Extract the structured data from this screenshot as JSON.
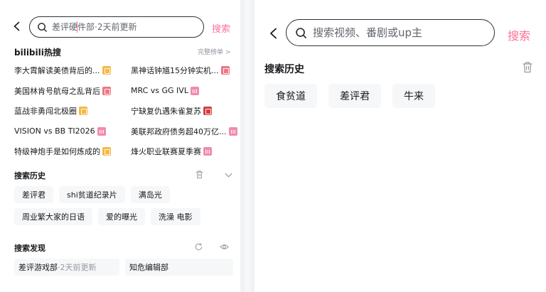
{
  "left": {
    "search": {
      "placeholder": "差评硬件部·2天前更新",
      "button": "搜索"
    },
    "hot": {
      "title": "bilibili热搜",
      "more": "完整榜单 >",
      "items": [
        {
          "text": "李大霄解读美债背后的...",
          "tag": "new"
        },
        {
          "text": "黑神话钟馗15分钟实机...",
          "tag": "hot"
        },
        {
          "text": "美国林肯号航母之乱背后",
          "tag": "hot"
        },
        {
          "text": "MRC vs GG IVL",
          "tag": "bar"
        },
        {
          "text": "蓝战非勇闯北极圈",
          "tag": "new"
        },
        {
          "text": "宁缺复仇遇朱雀复苏",
          "tag": "qi"
        },
        {
          "text": "VISION vs BB TI2026",
          "tag": "bar"
        },
        {
          "text": "美联邦政府债务超40万亿...",
          "tag": "bar"
        },
        {
          "text": "特级神炮手是如何炼成的",
          "tag": "new"
        },
        {
          "text": "烽火职业联赛夏季赛",
          "tag": "bar"
        }
      ]
    },
    "history": {
      "title": "搜索历史",
      "row1": [
        "差评君",
        "shi贫道纪录片",
        "满岛光"
      ],
      "row2": [
        "周业繁大家的日语",
        "爱的曝光",
        "洗澡 电影"
      ]
    },
    "discover": {
      "title": "搜索发现",
      "items": [
        {
          "main": "差评游戏部",
          "sub": "·2天前更新"
        },
        {
          "main": "知危编辑部",
          "sub": ""
        }
      ]
    }
  },
  "right": {
    "search": {
      "placeholder": "搜索视频、番剧或up主",
      "button": "搜索"
    },
    "history": {
      "title": "搜索历史",
      "items": [
        "食贫道",
        "差评君",
        "牛来"
      ]
    }
  },
  "colors": {
    "accent": "#fb7299",
    "chip_bg": "#f6f7f8",
    "text": "#18191c",
    "muted": "#9499a0"
  }
}
